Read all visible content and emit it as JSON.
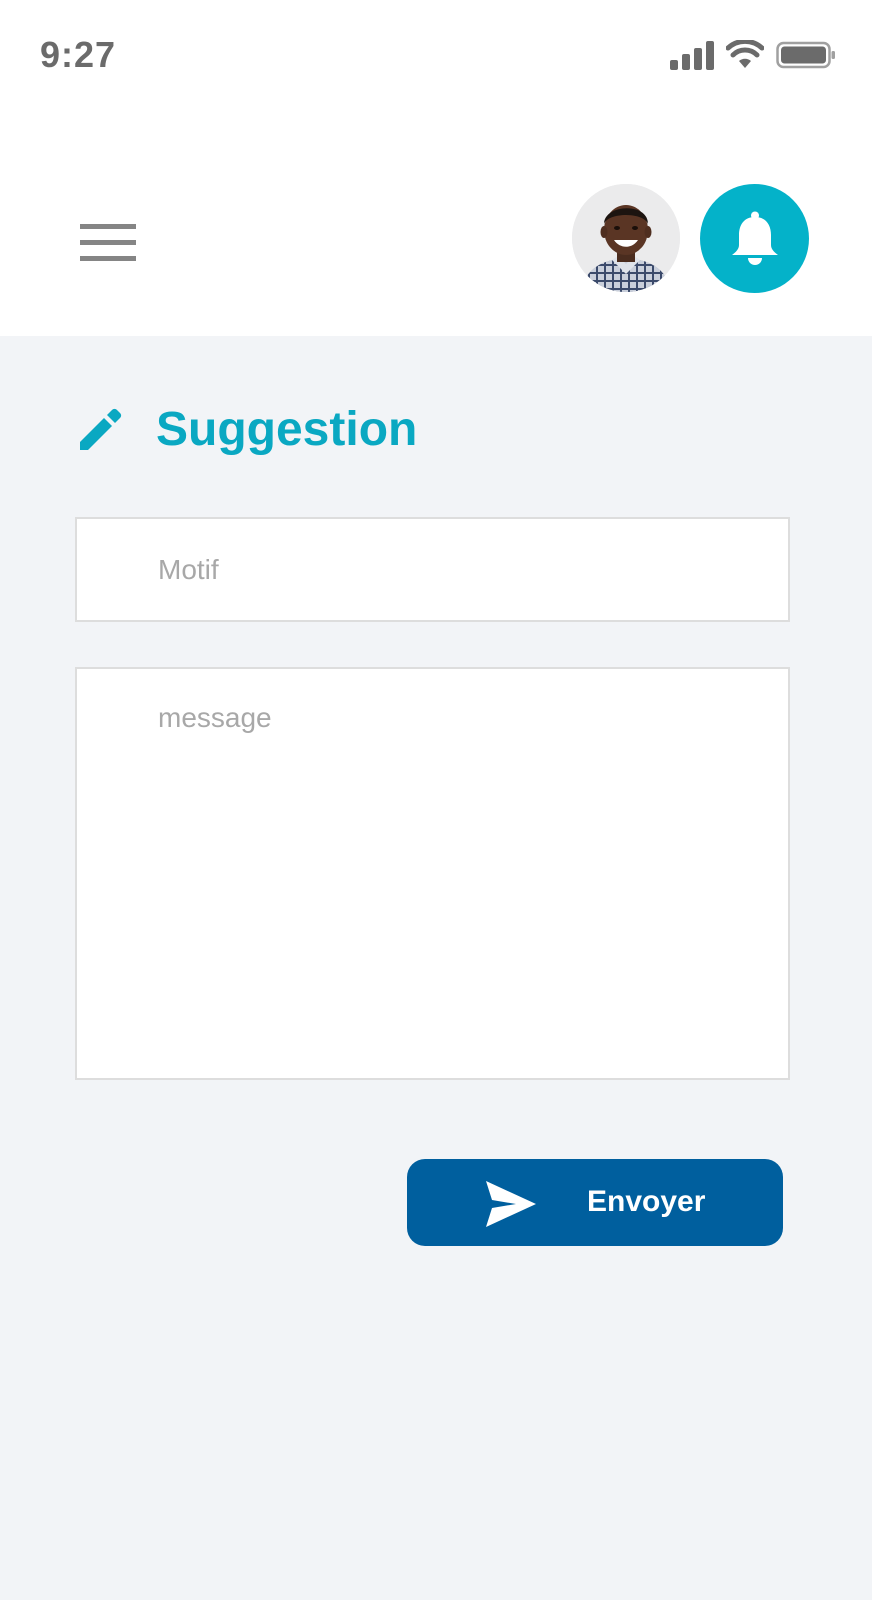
{
  "status_bar": {
    "time": "9:27",
    "icons": [
      "signal-icon",
      "wifi-icon",
      "battery-icon"
    ]
  },
  "header": {
    "menu_icon": "hamburger-menu-icon",
    "avatar_alt": "user avatar",
    "notification_icon": "bell-icon"
  },
  "page": {
    "title_icon": "pencil-icon",
    "title": "Suggestion"
  },
  "form": {
    "motif_placeholder": "Motif",
    "motif_value": "",
    "message_placeholder": "message",
    "message_value": "",
    "submit_label": "Envoyer",
    "submit_icon": "send-icon"
  },
  "colors": {
    "accent": "#04b2c9",
    "title": "#0aa8c2",
    "button": "#005f9e",
    "background": "#f2f4f7"
  }
}
